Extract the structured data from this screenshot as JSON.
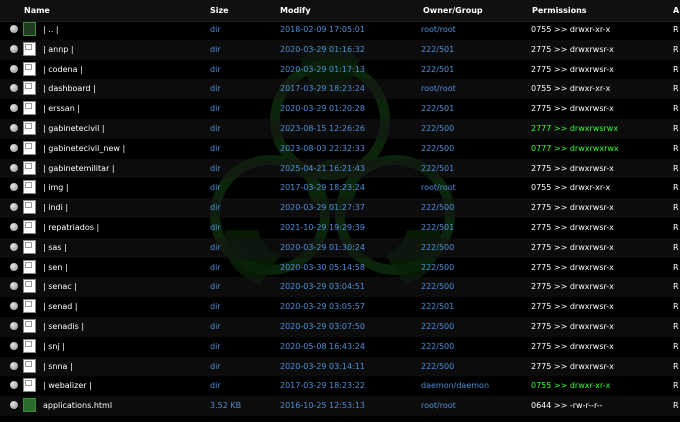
{
  "header": {
    "name": "Name",
    "size": "Size",
    "modify": "Modify",
    "owner_group": "Owner/Group",
    "permissions": "Permissions",
    "actions": "A"
  },
  "rows": [
    {
      "name": "| .. |",
      "size": "dir",
      "modify": "2018-02-09 17:05:01",
      "owner": "root/root",
      "perms": "0755 >> drwxr-xr-x",
      "writable": false,
      "action": "R",
      "icon": "folder-up-icon"
    },
    {
      "name": "| annp |",
      "size": "dir",
      "modify": "2020-03-29 01:16:32",
      "owner": "222/501",
      "perms": "2775 >> drwxrwsr-x",
      "writable": false,
      "action": "R",
      "icon": "folder-icon"
    },
    {
      "name": "| codena |",
      "size": "dir",
      "modify": "2020-03-29 01:17:13",
      "owner": "222/501",
      "perms": "2775 >> drwxrwsr-x",
      "writable": false,
      "action": "R",
      "icon": "folder-icon"
    },
    {
      "name": "| dashboard |",
      "size": "dir",
      "modify": "2017-03-29 18:23:24",
      "owner": "root/root",
      "perms": "0755 >> drwxr-xr-x",
      "writable": false,
      "action": "R",
      "icon": "folder-icon"
    },
    {
      "name": "| erssan |",
      "size": "dir",
      "modify": "2020-03-29 01:20:28",
      "owner": "222/501",
      "perms": "2775 >> drwxrwsr-x",
      "writable": false,
      "action": "R",
      "icon": "folder-icon"
    },
    {
      "name": "| gabinetecivil |",
      "size": "dir",
      "modify": "2023-08-15 12:26:26",
      "owner": "222/500",
      "perms": "2777 >> drwxrwsrwx",
      "writable": true,
      "action": "R",
      "icon": "folder-icon"
    },
    {
      "name": "| gabinetecivil_new |",
      "size": "dir",
      "modify": "2023-08-03 22:32:33",
      "owner": "222/500",
      "perms": "0777 >> drwxrwxrwx",
      "writable": true,
      "action": "R",
      "icon": "folder-icon"
    },
    {
      "name": "| gabinetemilitar |",
      "size": "dir",
      "modify": "2025-04-21 16:21:43",
      "owner": "222/501",
      "perms": "2775 >> drwxrwsr-x",
      "writable": false,
      "action": "R",
      "icon": "folder-icon"
    },
    {
      "name": "| img |",
      "size": "dir",
      "modify": "2017-03-29 18:23:24",
      "owner": "root/root",
      "perms": "0755 >> drwxr-xr-x",
      "writable": false,
      "action": "R",
      "icon": "folder-icon"
    },
    {
      "name": "| indi |",
      "size": "dir",
      "modify": "2020-03-29 01:27:37",
      "owner": "222/500",
      "perms": "2775 >> drwxrwsr-x",
      "writable": false,
      "action": "R",
      "icon": "folder-icon"
    },
    {
      "name": "| repatriados |",
      "size": "dir",
      "modify": "2021-10-29 19:29:39",
      "owner": "222/501",
      "perms": "2775 >> drwxrwsr-x",
      "writable": false,
      "action": "R",
      "icon": "folder-icon"
    },
    {
      "name": "| sas |",
      "size": "dir",
      "modify": "2020-03-29 01:30:24",
      "owner": "222/500",
      "perms": "2775 >> drwxrwsr-x",
      "writable": false,
      "action": "R",
      "icon": "folder-icon"
    },
    {
      "name": "| sen |",
      "size": "dir",
      "modify": "2020-03-30 05:14:58",
      "owner": "222/500",
      "perms": "2775 >> drwxrwsr-x",
      "writable": false,
      "action": "R",
      "icon": "folder-icon"
    },
    {
      "name": "| senac |",
      "size": "dir",
      "modify": "2020-03-29 03:04:51",
      "owner": "222/500",
      "perms": "2775 >> drwxrwsr-x",
      "writable": false,
      "action": "R",
      "icon": "folder-icon"
    },
    {
      "name": "| senad |",
      "size": "dir",
      "modify": "2020-03-29 03:05:57",
      "owner": "222/501",
      "perms": "2775 >> drwxrwsr-x",
      "writable": false,
      "action": "R",
      "icon": "folder-icon"
    },
    {
      "name": "| senadis |",
      "size": "dir",
      "modify": "2020-03-29 03:07:50",
      "owner": "222/500",
      "perms": "2775 >> drwxrwsr-x",
      "writable": false,
      "action": "R",
      "icon": "folder-icon"
    },
    {
      "name": "| snj |",
      "size": "dir",
      "modify": "2020-05-08 16:43:24",
      "owner": "222/500",
      "perms": "2775 >> drwxrwsr-x",
      "writable": false,
      "action": "R",
      "icon": "folder-icon"
    },
    {
      "name": "| snna |",
      "size": "dir",
      "modify": "2020-03-29 03:14:11",
      "owner": "222/500",
      "perms": "2775 >> drwxrwsr-x",
      "writable": false,
      "action": "R",
      "icon": "folder-icon"
    },
    {
      "name": "| webalizer |",
      "size": "dir",
      "modify": "2017-03-29 18:23:22",
      "owner": "daemon/daemon",
      "perms": "0755 >> drwxr-xr-x",
      "writable": true,
      "action": "R",
      "icon": "folder-icon"
    },
    {
      "name": "applications.html",
      "size": "3.52 KB",
      "modify": "2016-10-25 12:53:13",
      "owner": "root/root",
      "perms": "0644 >> -rw-r--r--",
      "writable": false,
      "action": "R",
      "icon": "file-icon"
    }
  ],
  "colors": {
    "background": "#000000",
    "link": "#4f8fd8",
    "writable": "#33ff33",
    "text": "#ffffff"
  }
}
